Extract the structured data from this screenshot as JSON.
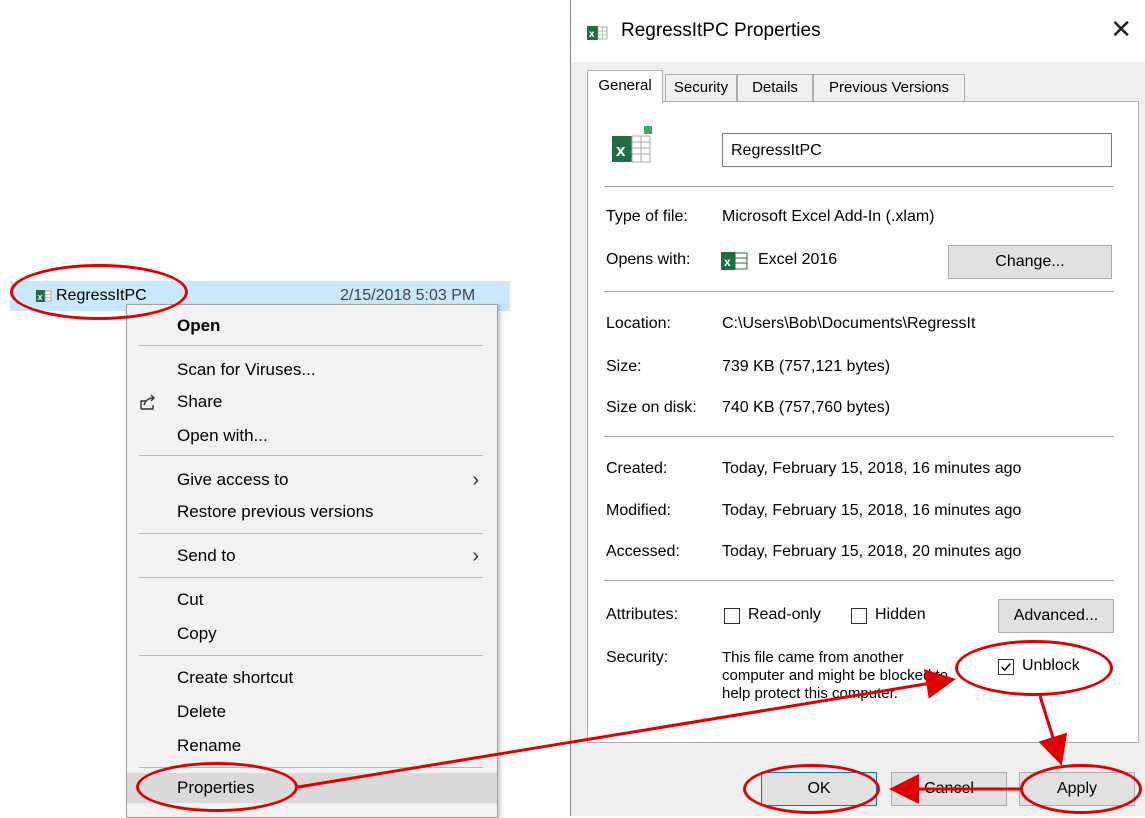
{
  "explorer": {
    "file_name": "RegressItPC",
    "file_date": "2/15/2018 5:03 PM"
  },
  "context_menu": {
    "items": [
      {
        "label": "Open"
      },
      {
        "label": "Scan for Viruses..."
      },
      {
        "label": "Share"
      },
      {
        "label": "Open with..."
      },
      {
        "label": "Give access to"
      },
      {
        "label": "Restore previous versions"
      },
      {
        "label": "Send to"
      },
      {
        "label": "Cut"
      },
      {
        "label": "Copy"
      },
      {
        "label": "Create shortcut"
      },
      {
        "label": "Delete"
      },
      {
        "label": "Rename"
      },
      {
        "label": "Properties"
      }
    ]
  },
  "dialog": {
    "title": "RegressItPC Properties",
    "tabs": [
      "General",
      "Security",
      "Details",
      "Previous Versions"
    ],
    "file_name_value": "RegressItPC",
    "type_label": "Type of file:",
    "type_value": "Microsoft Excel Add-In (.xlam)",
    "opens_label": "Opens with:",
    "opens_value": "Excel 2016",
    "change_button": "Change...",
    "location_label": "Location:",
    "location_value": "C:\\Users\\Bob\\Documents\\RegressIt",
    "size_label": "Size:",
    "size_value": "739 KB (757,121 bytes)",
    "size_disk_label": "Size on disk:",
    "size_disk_value": "740 KB (757,760 bytes)",
    "created_label": "Created:",
    "created_value": "Today, February 15, 2018, 16 minutes ago",
    "modified_label": "Modified:",
    "modified_value": "Today, February 15, 2018, 16 minutes ago",
    "accessed_label": "Accessed:",
    "accessed_value": "Today, February 15, 2018, 20 minutes ago",
    "attributes_label": "Attributes:",
    "readonly_label": "Read-only",
    "hidden_label": "Hidden",
    "advanced_button": "Advanced...",
    "security_label": "Security:",
    "security_text_1": "This file came from another",
    "security_text_2": "computer and might be blocked to",
    "security_text_3": "help protect this computer.",
    "unblock_label": "Unblock",
    "unblock_checked": true,
    "ok_button": "OK",
    "cancel_button": "Cancel",
    "apply_button": "Apply"
  },
  "colors": {
    "selection": "#cce8ff",
    "annotation": "#e00000",
    "excel_green": "#1d6f42"
  }
}
